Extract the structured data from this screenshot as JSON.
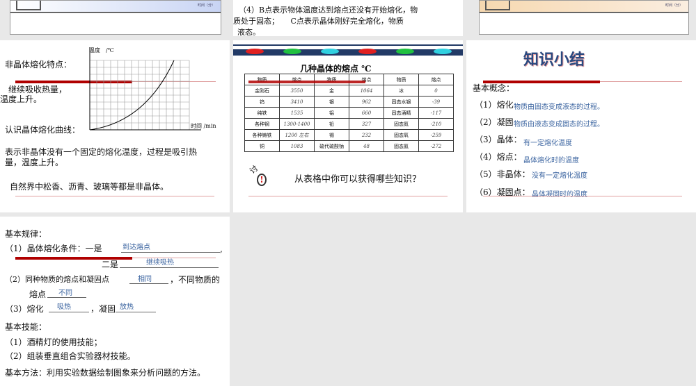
{
  "top": {
    "left_axis_label": "时间（分）",
    "right_axis_label": "时间（分）",
    "middle_lines": [
      "（4）B点表示物体温度达到熔点还没有开始熔化，物",
      "质处于固态；　　C点表示晶体刚好完全熔化，物质",
      "液态。"
    ]
  },
  "slide_amorphous": {
    "title": "非晶体熔化特点：",
    "line1": "继续吸收热量，",
    "line2": "温度上升。",
    "curve_label": "认识晶体熔化曲线：",
    "y_axis": "温度　/℃",
    "x_axis": "时间 /min",
    "desc1": "表示非晶体没有一个固定的熔化温度，过程是吸引热",
    "desc2": "量，温度上升。",
    "examples": "自然界中松香、沥青、玻璃等都是非晶体。"
  },
  "slide_table": {
    "title": "几种晶体的熔点 ℃",
    "headers": [
      "物质",
      "熔点",
      "物质",
      "熔点",
      "物质",
      "熔点"
    ],
    "rows": [
      [
        "金刚石",
        "3550",
        "金",
        "1064",
        "冰",
        "0"
      ],
      [
        "钨",
        "3410",
        "银",
        "962",
        "固态水银",
        "-39"
      ],
      [
        "纯铁",
        "1535",
        "铝",
        "660",
        "固态酒精",
        "-117"
      ],
      [
        "各种钢",
        "1300-1400",
        "铅",
        "327",
        "固态氮",
        "-210"
      ],
      [
        "各种铸铁",
        "1200 左右",
        "锡",
        "232",
        "固态氧",
        "-259"
      ],
      [
        "铜",
        "1083",
        "硫代硫酸钠",
        "48",
        "固态氦",
        "-272"
      ]
    ],
    "discuss_icon": "讨",
    "question": "从表格中你可以获得哪些知识？"
  },
  "slide_summary": {
    "title": "知识小结",
    "heading": "基本概念：",
    "items": [
      [
        "（1）熔化",
        "物质由固态变成液态的过程。"
      ],
      [
        "（2）凝固",
        "物质由液态变成固态的过程。"
      ],
      [
        "（3）晶体：",
        "有一定熔化温度"
      ],
      [
        "（4）熔点：",
        "晶体熔化时的温度"
      ],
      [
        "（5）非晶体：",
        "没有一定熔化温度"
      ],
      [
        "（6）凝固点：",
        "晶体凝固时的温度"
      ]
    ]
  },
  "slide_rules": {
    "heading": "基本规律：",
    "r1a": "（1）晶体熔化条件：一是",
    "r1a_fill": "到达熔点",
    "r1b": "二是",
    "r1b_fill": "继续吸热",
    "r2": "（2）同种物质的熔点和凝固点",
    "r2_fill": "相同",
    "r2b": "，不同物质的",
    "r2c": "熔点",
    "r2c_fill": "不同",
    "r3a": "（3）熔化",
    "r3a_fill": "吸热",
    "r3b": "，凝固",
    "r3b_fill": "放热",
    "skills": "基本技能：",
    "s1": "（1）酒精灯的使用技能；",
    "s2": "（2）组装垂直组合实验器材技能。",
    "method": "基本方法：利用实验数据绘制图象来分析问题的方法。"
  }
}
